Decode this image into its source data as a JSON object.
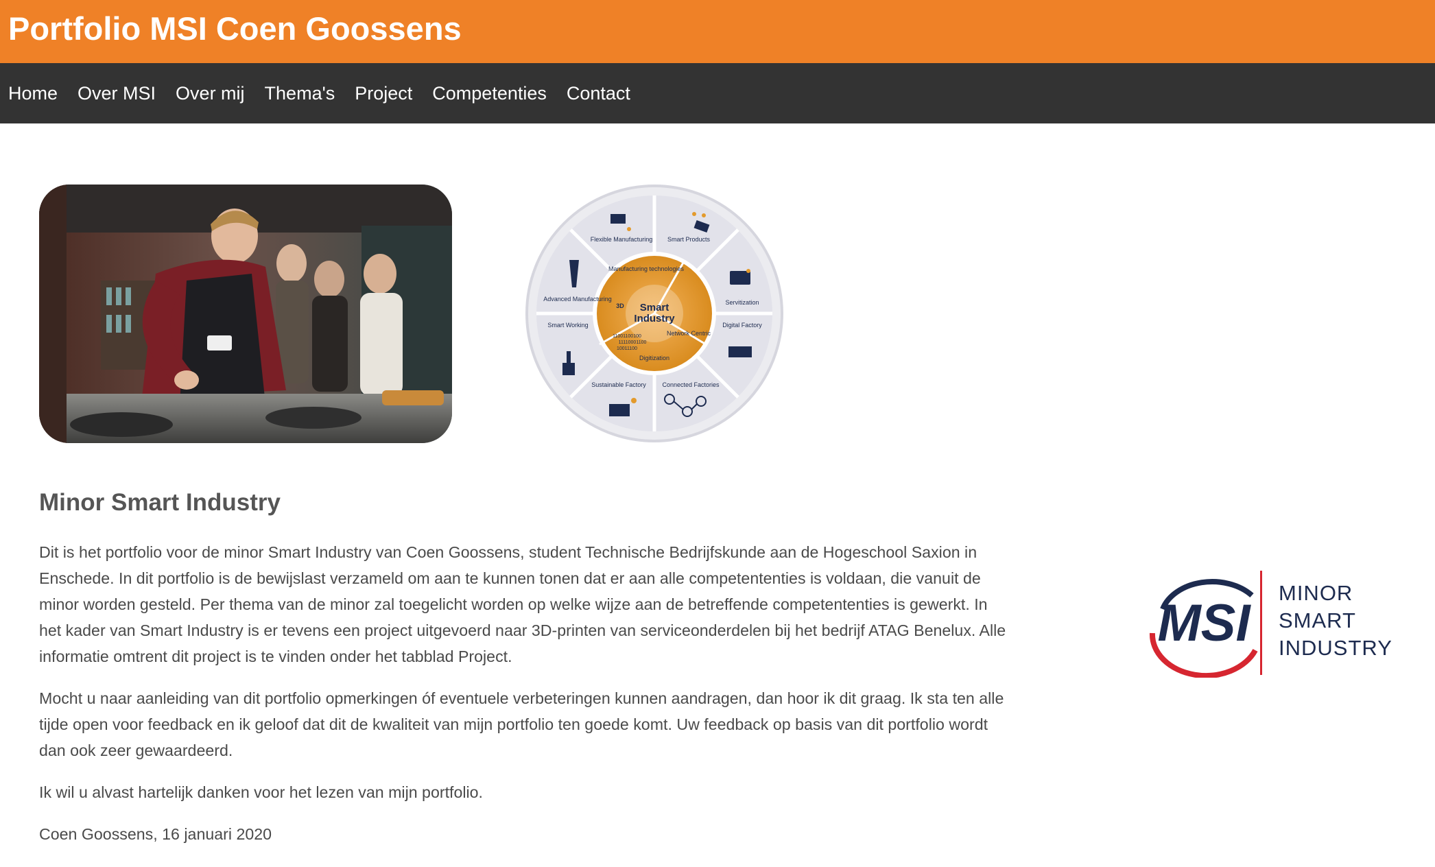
{
  "header": {
    "title": "Portfolio MSI Coen Goossens"
  },
  "nav": [
    "Home",
    "Over MSI",
    "Over mij",
    "Thema's",
    "Project",
    "Competenties",
    "Contact"
  ],
  "wheel": {
    "center_title_1": "Smart",
    "center_title_2": "Industry",
    "inner": [
      "Manufacturing technologies",
      "3D",
      "Network Centric",
      "Digitization"
    ],
    "binary": [
      "11001100100",
      "11110001100",
      "10011100"
    ],
    "segments": [
      "Flexible Manufacturing",
      "Smart Products",
      "Servitization",
      "Digital Factory",
      "Connected Factories",
      "Sustainable Factory",
      "Smart Working",
      "Advanced Manufacturing"
    ]
  },
  "logo": {
    "mark": "MSI",
    "line1": "MINOR",
    "line2": "SMART",
    "line3": "INDUSTRY"
  },
  "content": {
    "heading": "Minor Smart Industry",
    "paragraphs": [
      "Dit is het portfolio voor de minor Smart Industry van Coen Goossens, student Technische Bedrijfskunde aan de Hogeschool Saxion in Enschede. In dit portfolio is de bewijslast verzameld om aan te kunnen tonen dat er aan alle competententies is voldaan, die vanuit de minor worden gesteld. Per thema van de minor zal toegelicht worden op welke wijze aan de betreffende competententies is gewerkt. In het kader van Smart Industry is er tevens een project uitgevoerd naar 3D-printen van serviceonderdelen bij het bedrijf ATAG Benelux. Alle informatie omtrent dit project is te vinden onder het tabblad Project.",
      "Mocht u naar aanleiding van dit portfolio opmerkingen óf eventuele verbeteringen kunnen aandragen, dan hoor ik dit graag. Ik sta ten alle tijde open voor feedback en ik geloof dat dit de kwaliteit van mijn portfolio ten goede komt. Uw feedback op basis van dit portfolio wordt dan ook zeer gewaardeerd.",
      "Ik wil u alvast hartelijk danken voor het lezen van mijn portfolio.",
      "Coen Goossens, 16 januari 2020"
    ]
  },
  "colors": {
    "orange": "#ef8127",
    "nav": "#333333",
    "navy": "#1d2b4f",
    "red": "#d62630"
  }
}
